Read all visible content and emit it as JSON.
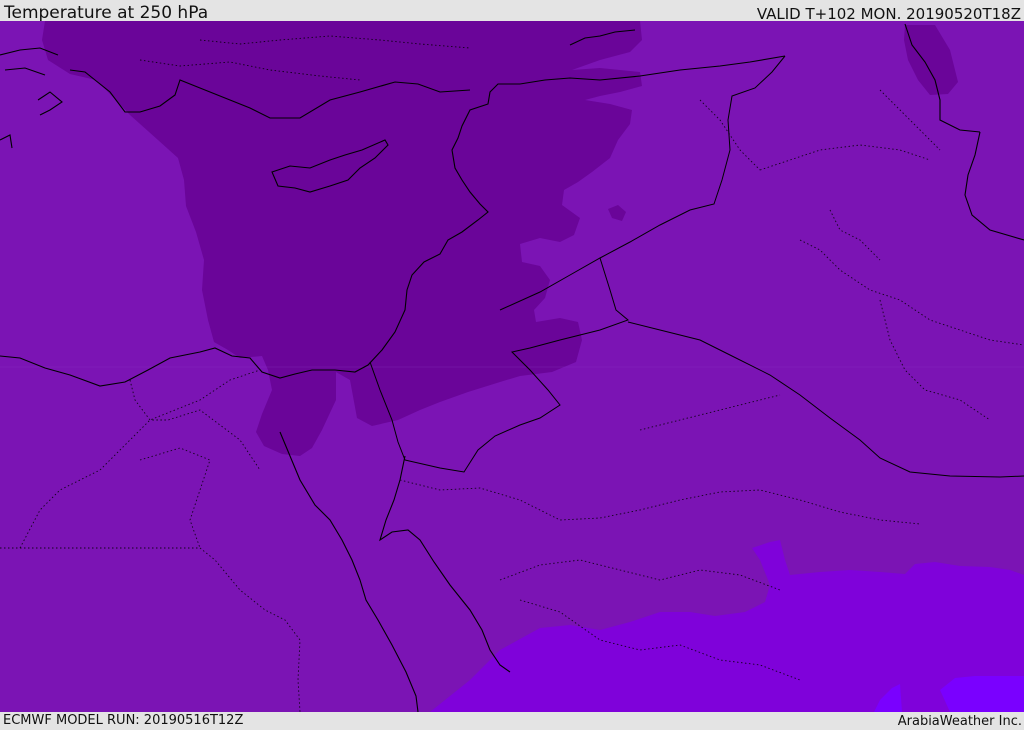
{
  "header": {
    "title": "Temperature at 250 hPa",
    "valid": "VALID T+102 MON. 20190520T18Z"
  },
  "footer": {
    "model_run": "ECMWF MODEL RUN: 20190516T12Z",
    "credit": "ArabiaWeather Inc."
  },
  "map": {
    "field": "temperature",
    "level": "250 hPa",
    "colors": {
      "background_band": "#7b14b4",
      "cold_band": "#6a0599",
      "warmer_band": "#7f02da",
      "warmest_band": "#7a00ff",
      "coastline": "#000000",
      "border": "#000000",
      "chrome": "#e4e4e4"
    }
  }
}
